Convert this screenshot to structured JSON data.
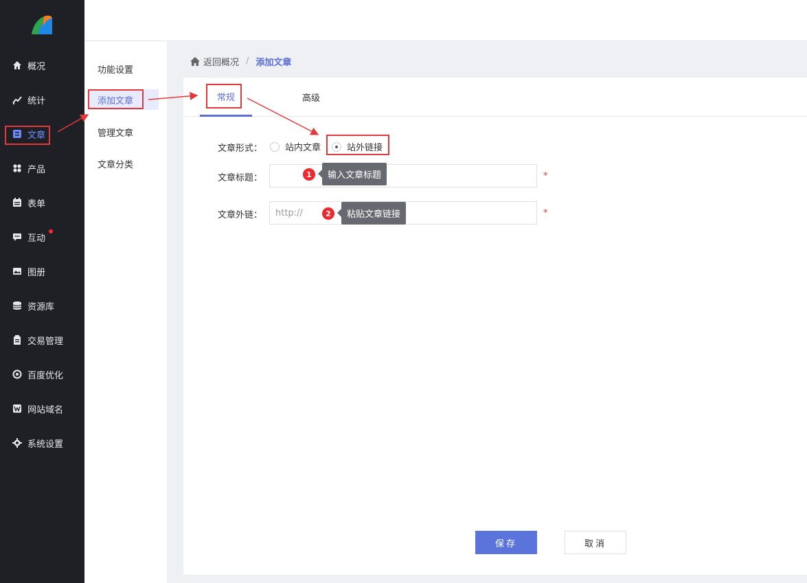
{
  "sidebar": {
    "items": [
      {
        "label": "概况",
        "icon": "home-icon"
      },
      {
        "label": "统计",
        "icon": "chart-icon"
      },
      {
        "label": "文章",
        "icon": "article-icon"
      },
      {
        "label": "产品",
        "icon": "grid-icon"
      },
      {
        "label": "表单",
        "icon": "form-icon"
      },
      {
        "label": "互动",
        "icon": "chat-icon"
      },
      {
        "label": "图册",
        "icon": "album-icon"
      },
      {
        "label": "资源库",
        "icon": "database-icon"
      },
      {
        "label": "交易管理",
        "icon": "trade-icon"
      },
      {
        "label": "百度优化",
        "icon": "seo-icon"
      },
      {
        "label": "网站域名",
        "icon": "domain-icon"
      },
      {
        "label": "系统设置",
        "icon": "gear-icon"
      }
    ]
  },
  "submenu": {
    "items": [
      "功能设置",
      "添加文章",
      "管理文章",
      "文章分类"
    ]
  },
  "breadcrumb": {
    "home": "返回概况",
    "current": "添加文章"
  },
  "tabs": [
    "常规",
    "高级"
  ],
  "form": {
    "type_label": "文章形式：",
    "type_options": [
      "站内文章",
      "站外链接"
    ],
    "type_selected": "站外链接",
    "title_label": "文章标题：",
    "title_value": "",
    "link_label": "文章外链：",
    "link_placeholder": "http://",
    "required_mark": "*"
  },
  "tips": [
    {
      "number": "1",
      "text": "输入文章标题"
    },
    {
      "number": "2",
      "text": "粘贴文章链接"
    }
  ],
  "buttons": {
    "save": "保存",
    "cancel": "取消"
  },
  "colors": {
    "accent": "#5b6fd6",
    "annotation": "#e03a3a",
    "sidebar_bg": "#1f2026"
  }
}
